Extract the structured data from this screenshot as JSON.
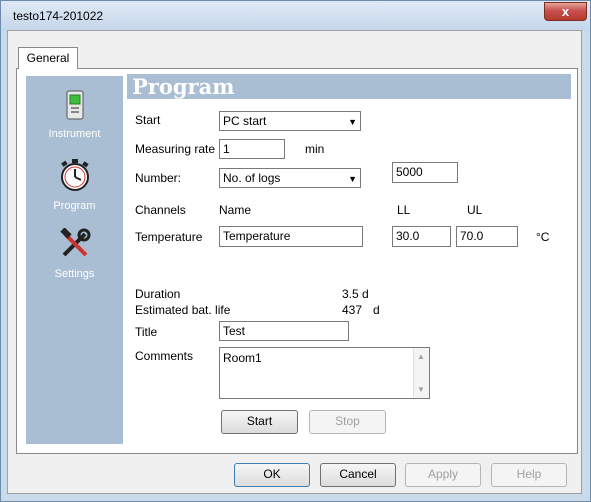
{
  "window": {
    "title": "testo174-201022",
    "close_glyph": "x"
  },
  "tabs": [
    {
      "label": "General"
    }
  ],
  "nav": {
    "items": [
      {
        "label": "Instrument",
        "icon": "device-icon"
      },
      {
        "label": "Program",
        "icon": "stopwatch-icon"
      },
      {
        "label": "Settings",
        "icon": "tools-icon"
      }
    ]
  },
  "program": {
    "header": "Program",
    "start_label": "Start",
    "start_value": "PC start",
    "measuring_rate_label": "Measuring rate",
    "measuring_rate_value": "1",
    "measuring_rate_unit": "min",
    "number_label": "Number:",
    "number_value": "No. of logs",
    "number_count": "5000",
    "channels_label": "Channels",
    "name_header": "Name",
    "ll_header": "LL",
    "ul_header": "UL",
    "channel_label": "Temperature",
    "channel_name": "Temperature",
    "ll_value": "30.0",
    "ul_value": "70.0",
    "unit": "°C",
    "duration_label": "Duration",
    "duration_value": "3.5 d",
    "battery_label": "Estimated bat. life",
    "battery_value": "437",
    "battery_unit": "d",
    "title_label": "Title",
    "title_value": "Test",
    "comments_label": "Comments",
    "comments_value": "Room1",
    "start_button": "Start",
    "stop_button": "Stop"
  },
  "footer": {
    "ok": "OK",
    "cancel": "Cancel",
    "apply": "Apply",
    "help": "Help"
  }
}
